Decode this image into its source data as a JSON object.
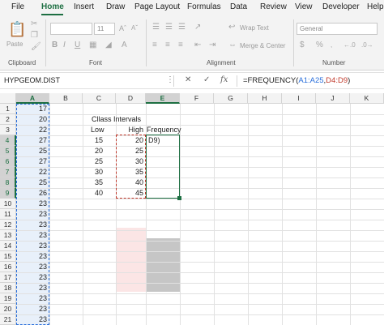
{
  "ribbon_tabs": [
    "File",
    "Home",
    "Insert",
    "Draw",
    "Page Layout",
    "Formulas",
    "Data",
    "Review",
    "View",
    "Developer",
    "Help"
  ],
  "active_tab": "Home",
  "ribbon": {
    "paste_label": "Paste",
    "clipboard_label": "Clipboard",
    "font_label": "Font",
    "font_size": "11",
    "alignment_label": "Alignment",
    "wrap_text": "Wrap Text",
    "merge_center": "Merge & Center",
    "number_label": "Number",
    "number_format": "General",
    "bold": "B",
    "italic": "I",
    "underline": "U",
    "currency": "$",
    "percent": "%"
  },
  "formula_bar": {
    "name_box": "HYPGEOM.DIST",
    "formula_prefix": "=FREQUENCY(",
    "formula_ref1": "A1:A25",
    "formula_comma": ",",
    "formula_ref2": "D4:D9",
    "formula_suffix": ")",
    "cancel_icon": "close-icon",
    "enter_icon": "check-icon",
    "fx": "fx"
  },
  "grid": {
    "columns": [
      "A",
      "B",
      "C",
      "D",
      "E",
      "F",
      "G",
      "H",
      "I",
      "J",
      "K"
    ],
    "rows": [
      "1",
      "2",
      "3",
      "4",
      "5",
      "6",
      "7",
      "8",
      "9",
      "10",
      "11",
      "12",
      "13",
      "14",
      "15",
      "16",
      "17",
      "18",
      "19",
      "20",
      "21"
    ],
    "col_a_values": [
      "17",
      "20",
      "22",
      "27",
      "25",
      "27",
      "22",
      "25",
      "26",
      "23",
      "23",
      "23",
      "23",
      "23",
      "23",
      "23",
      "23",
      "23",
      "23",
      "23",
      "23"
    ],
    "class_intervals_title": "Cllass Intervals",
    "header_low": "Low",
    "header_high": "High",
    "header_frequency": "Frequency",
    "low_values": [
      "15",
      "20",
      "25",
      "30",
      "35",
      "40"
    ],
    "high_values": [
      "20",
      "25",
      "30",
      "35",
      "40",
      "45"
    ],
    "edit_cell": "D9)"
  },
  "colors": {
    "accent": "#1d6f42",
    "ref_blue": "#2a6fdb",
    "ref_red": "#c0392b"
  }
}
